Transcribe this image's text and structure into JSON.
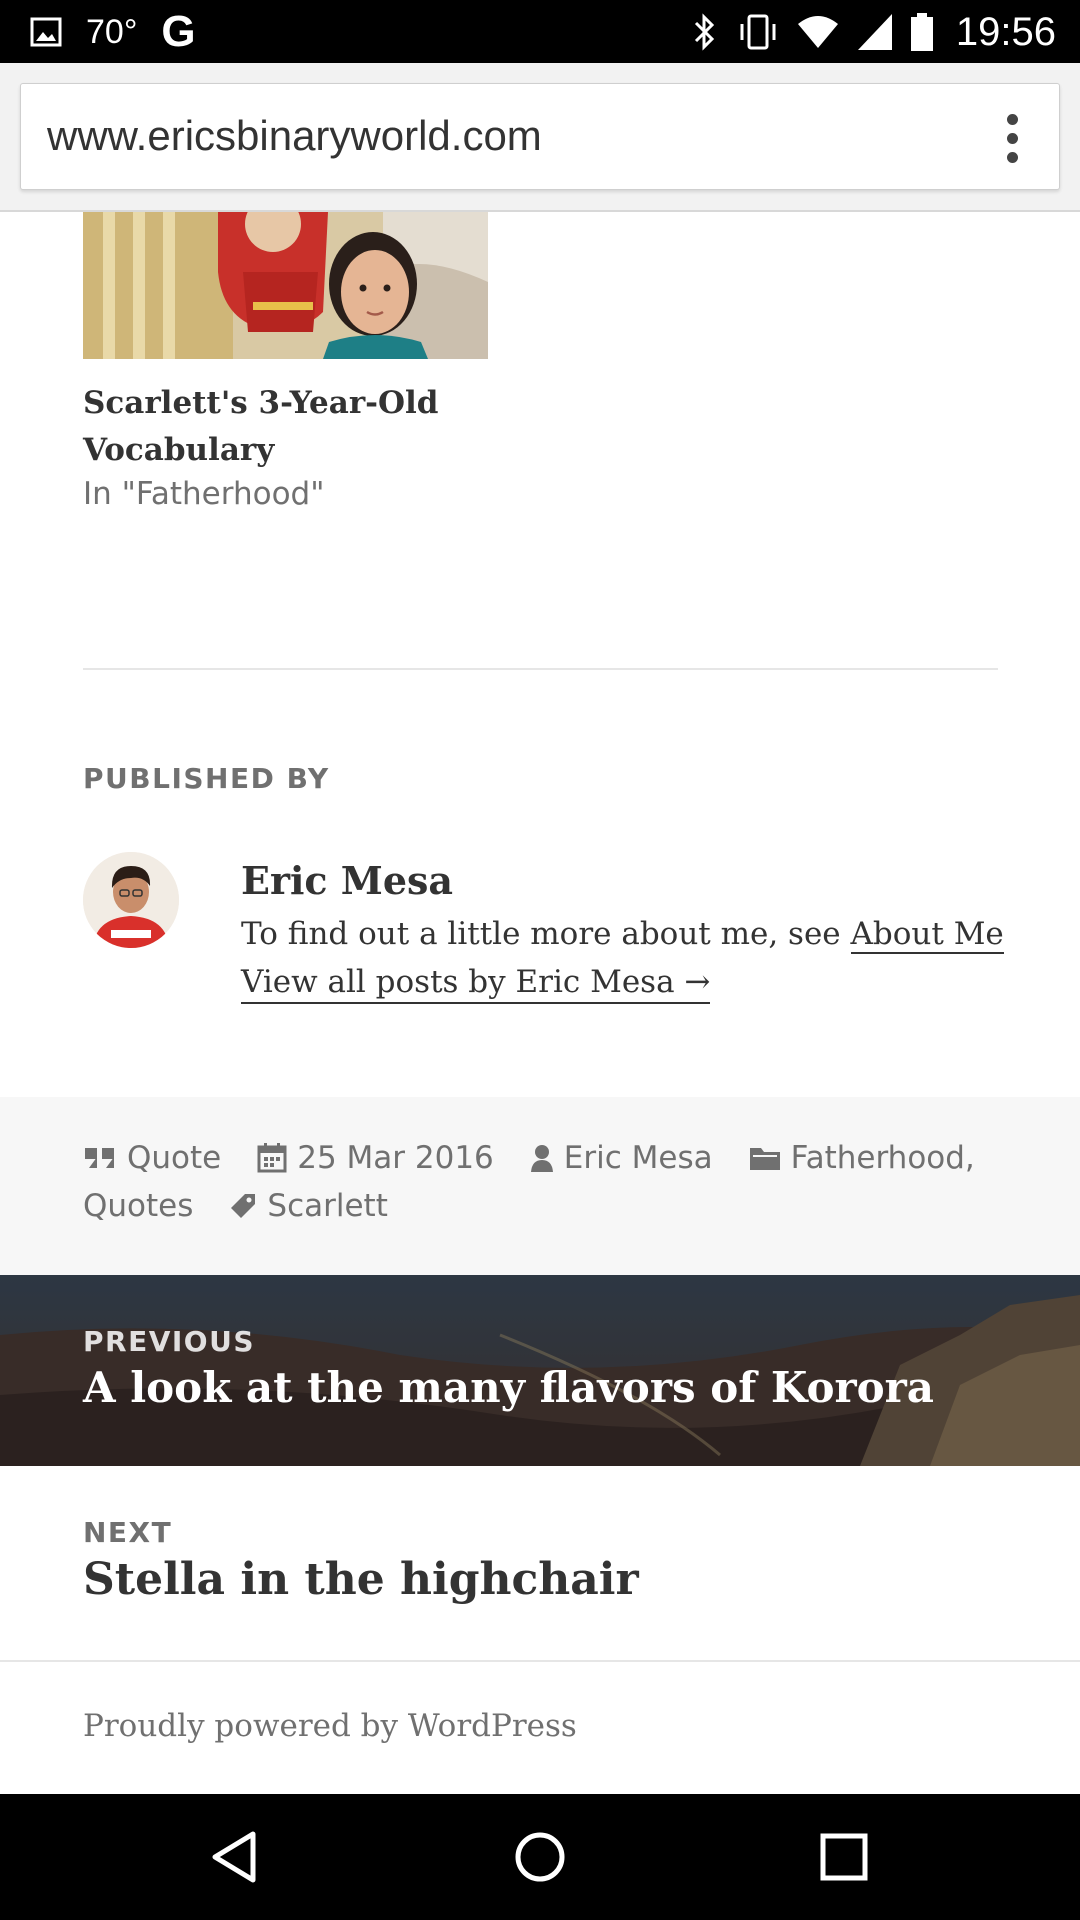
{
  "status_bar": {
    "temperature": "70°",
    "google_letter": "G",
    "time": "19:56",
    "icons": [
      "image-notification-icon",
      "bluetooth-icon",
      "vibrate-icon",
      "wifi-icon",
      "cellular-signal-icon",
      "battery-icon"
    ]
  },
  "browser": {
    "url": "www.ericsbinaryworld.com",
    "menu_icon": "more-vert-icon"
  },
  "related_post": {
    "title": "Scarlett's 3-Year-Old Vocabulary",
    "category": "In \"Fatherhood\""
  },
  "author_box": {
    "heading": "PUBLISHED BY",
    "name": "Eric Mesa",
    "bio_text": "To find out a little more about me, see ",
    "bio_link": "About Me",
    "view_all_link": "View all posts by Eric Mesa →"
  },
  "entry_meta": {
    "format": "Quote",
    "date": "25 Mar 2016",
    "author": "Eric Mesa",
    "category_1": "Fatherhood,",
    "category_2": "Quotes",
    "tag": "Scarlett"
  },
  "post_navigation": {
    "previous_label": "PREVIOUS",
    "previous_title": "A look at the many flavors of Korora",
    "next_label": "NEXT",
    "next_title": "Stella in the highchair"
  },
  "site_footer": {
    "credit": "Proudly powered by WordPress"
  },
  "colors": {
    "text_dark": "#333333",
    "text_muted": "#707070",
    "meta_background": "#f7f7f7",
    "status_bar": "#000000"
  }
}
